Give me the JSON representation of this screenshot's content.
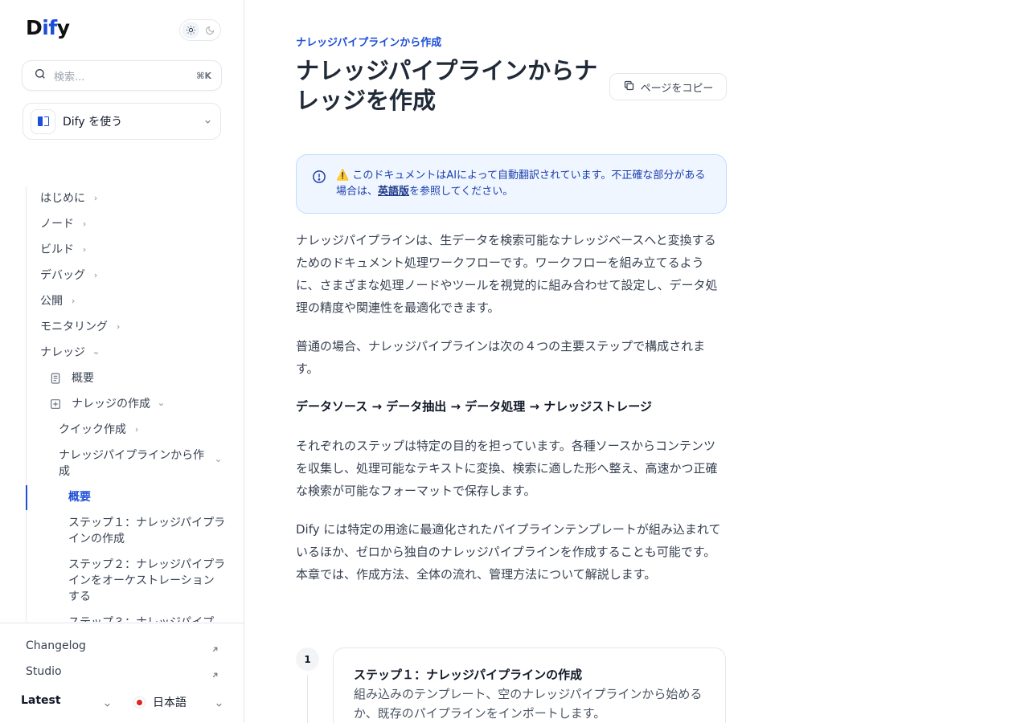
{
  "sidebar": {
    "logo": {
      "pre": "D",
      "accent": "if",
      "post": "y"
    },
    "search": {
      "placeholder": "検索...",
      "shortcut": "⌘K"
    },
    "product": {
      "label": "Dify を使う"
    },
    "nav": {
      "hajimeni": "はじめに",
      "node": "ノード",
      "build": "ビルド",
      "debug": "デバッグ",
      "publish": "公開",
      "monitoring": "モニタリング",
      "knowledge": "ナレッジ",
      "overview": "概要",
      "create_knowledge": "ナレッジの作成",
      "quick_create": "クイック作成",
      "pipeline_create_1": "ナレッジパイプラインから作",
      "pipeline_create_2": "成",
      "active_overview": "概要",
      "step1_1": "ステップ１：ナレッジパイプラ",
      "step1_2": "インの作成",
      "step2_1": "ステップ２：ナレッジパイプラ",
      "step2_2": "インをオーケストレーション",
      "step2_3": "する",
      "step3_1": "ステップ３：ナレッジパイプ"
    },
    "footer": {
      "changelog": "Changelog",
      "studio": "Studio",
      "version": "Latest",
      "language": "日本語"
    }
  },
  "main": {
    "eyebrow": "ナレッジパイプラインから作成",
    "title": "ナレッジパイプラインからナレッジを作成",
    "copy_button": "ページをコピー",
    "callout": {
      "before": "⚠️ このドキュメントはAIによって自動翻訳されています。不正確な部分がある場合は、",
      "link": "英語版",
      "after": "を参照してください。"
    },
    "para1": "ナレッジパイプラインは、生データを検索可能なナレッジベースへと変換するためのドキュメント処理ワークフローです。ワークフローを組み立てるように、さまざまな処理ノードやツールを視覚的に組み合わせて設定し、データ処理の精度や関連性を最適化できます。",
    "para2": "普通の場合、ナレッジパイプラインは次の４つの主要ステップで構成されます。",
    "flow": "データソース → データ抽出 → データ処理 → ナレッジストレージ",
    "para3": "それぞれのステップは特定の目的を担っています。各種ソースからコンテンツを収集し、処理可能なテキストに変換、検索に適した形へ整え、高速かつ正確な検索が可能なフォーマットで保存します。",
    "para4": "Dify には特定の用途に最適化されたパイプラインテンプレートが組み込まれているほか、ゼロから独自のナレッジパイプラインを作成することも可能です。本章では、作成方法、全体の流れ、管理方法について解説します。",
    "step": {
      "number": "1",
      "title": "ステップ１：ナレッジパイプラインの作成",
      "description": "組み込みのテンプレート、空のナレッジパイプラインから始めるか、既存のパイプラインをインポートします。"
    }
  },
  "colors": {
    "accent": "#1d4ed8",
    "callout_bg": "#eff6ff",
    "callout_border": "#bfdbfe"
  }
}
